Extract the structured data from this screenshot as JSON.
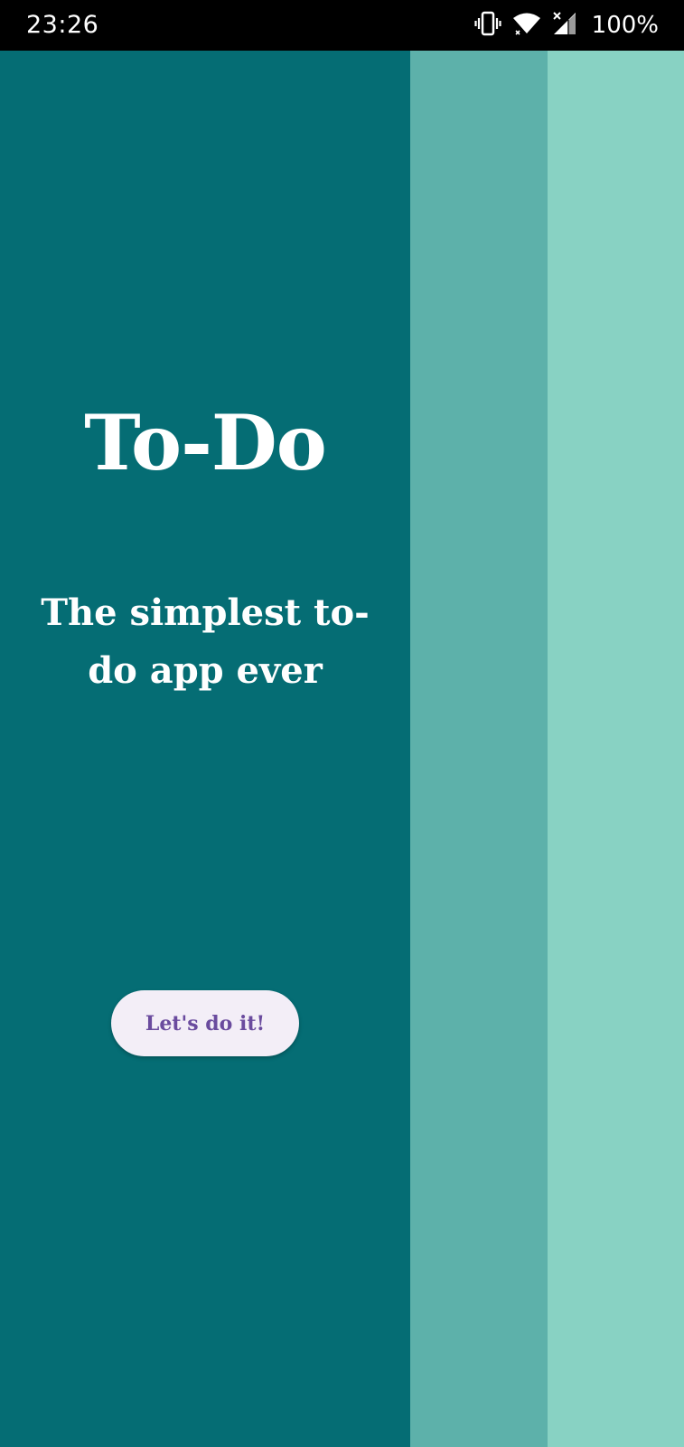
{
  "status_bar": {
    "time": "23:26",
    "battery": "100%",
    "icons": [
      "vibrate-icon",
      "wifi-icon",
      "signal-icon"
    ]
  },
  "colors": {
    "panel_main": "#056d74",
    "panel_mid": "#5db1aa",
    "panel_right": "#88d2c3",
    "button_bg": "#f3eef7",
    "button_text": "#6a4b9e"
  },
  "welcome": {
    "title": "To-Do",
    "subtitle": "The simplest to-do app ever",
    "cta_label": "Let's do it!"
  }
}
